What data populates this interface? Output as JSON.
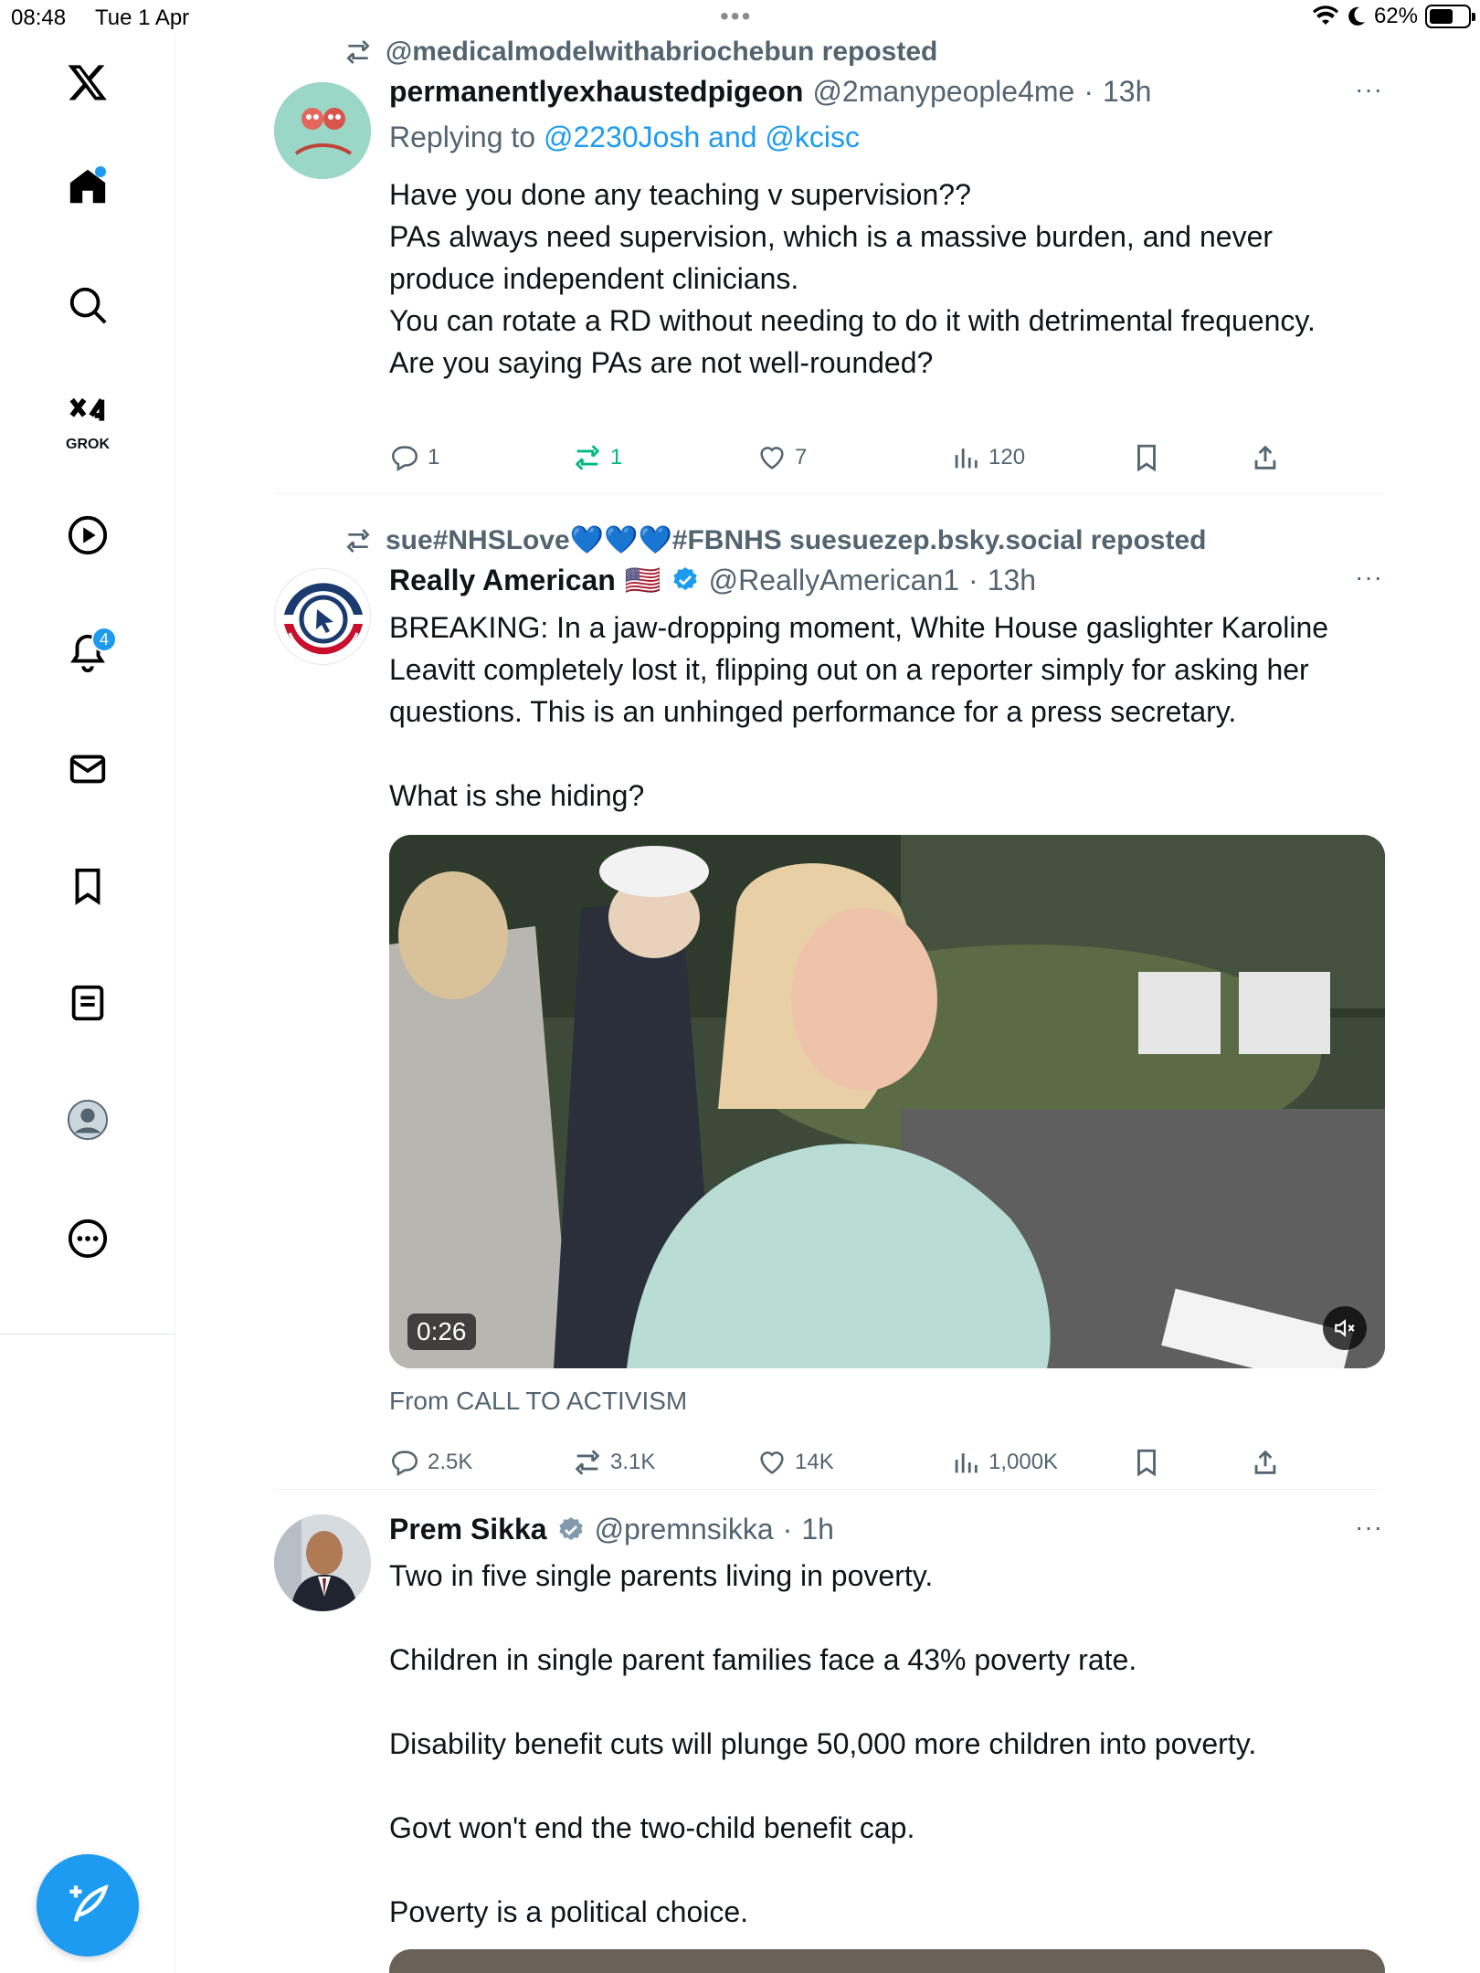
{
  "status_bar": {
    "time": "08:48",
    "date": "Tue 1 Apr",
    "battery": "62%",
    "battery_level": 0.62
  },
  "sidebar": {
    "grok_label": "GROK",
    "notifications_count": "4"
  },
  "posts": [
    {
      "repost_by": "@medicalmodelwithabriochebun reposted",
      "name": "permanentlyexhaustedpigeon",
      "handle": "@2manypeople4me",
      "time": "13h",
      "replying_prefix": "Replying to",
      "replying_users": "@2230Josh and @kcisc",
      "lines": [
        "Have you done any teaching v supervision??",
        "PAs always need supervision, which is a massive burden, and never produce independent clinicians.",
        "You can rotate a RD without needing to do it with detrimental frequency.",
        "Are you saying PAs are not well-rounded?"
      ],
      "stats": {
        "replies": "1",
        "reposts": "1",
        "likes": "7",
        "views": "120"
      }
    },
    {
      "repost_by": "sue#NHSLove💙💙💙#FBNHS suesuezep.bsky.social reposted",
      "name": "Really American",
      "flag": "🇺🇸",
      "handle": "@ReallyAmerican1",
      "time": "13h",
      "lines": [
        "BREAKING: In a jaw-dropping moment, White House gaslighter Karoline Leavitt completely lost it, flipping out on a reporter simply for asking her questions. This is an unhinged performance for a press secretary.",
        "What is she hiding?"
      ],
      "video_duration": "0:26",
      "source": "From CALL TO ACTIVISM",
      "stats": {
        "replies": "2.5K",
        "reposts": "3.1K",
        "likes": "14K",
        "views": "1,000K"
      }
    },
    {
      "name": "Prem Sikka",
      "handle": "@premnsikka",
      "time": "1h",
      "lines": [
        "Two in five single parents living in poverty.",
        "Children in single parent families face a 43% poverty rate.",
        "Disability benefit cuts will plunge 50,000 more children into poverty.",
        "Govt won't end the two-child benefit cap.",
        "Poverty is a political choice."
      ]
    }
  ],
  "separator": "·",
  "more": "···",
  "colors": {
    "accent": "#1d9bf0",
    "muted": "#536471",
    "repost_green": "#00ba7c"
  }
}
